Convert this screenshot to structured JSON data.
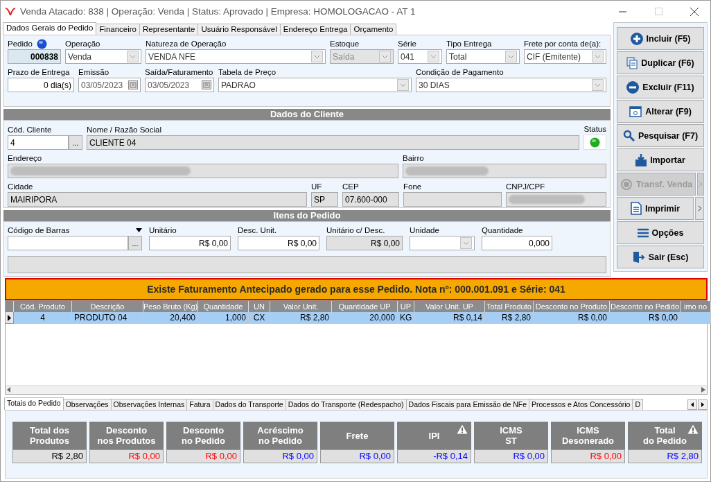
{
  "window": {
    "title": "Venda Atacado: 838 | Operação: Venda | Status: Aprovado | Empresa: HOMOLOGACAO - AT 1"
  },
  "tabs": [
    {
      "label": "Dados Gerais do Pedido",
      "selected": true
    },
    {
      "label": "Financeiro",
      "selected": false
    },
    {
      "label": "Representante",
      "selected": false
    },
    {
      "label": "Usuário Responsável",
      "selected": false
    },
    {
      "label": "Endereço Entrega",
      "selected": false
    },
    {
      "label": "Orçamento",
      "selected": false
    }
  ],
  "general": [
    [
      {
        "label": "Pedido",
        "kind": "id",
        "value": "000838",
        "color": "#1a4fd0"
      },
      {
        "label": "Operação",
        "kind": "combo",
        "value": "Venda",
        "disabled": false
      },
      {
        "label": "Natureza de Operação",
        "kind": "combo",
        "value": "VENDA NFE",
        "disabled": false
      },
      {
        "label": "Estoque",
        "kind": "combo",
        "value": "Saída",
        "disabled": true
      },
      {
        "label": "Série",
        "kind": "combo",
        "value": "041",
        "disabled": false
      },
      {
        "label": "Tipo Entrega",
        "kind": "combo",
        "value": "Total",
        "disabled": false
      },
      {
        "label": "Frete por conta de(a):",
        "kind": "combo",
        "value": "CIF (Emitente)",
        "disabled": false
      }
    ],
    [
      {
        "label": "Prazo de Entrega",
        "kind": "number",
        "value": "0 dia(s)"
      },
      {
        "label": "Emissão",
        "kind": "date",
        "value": "03/05/2023"
      },
      {
        "label": "Saída/Faturamento",
        "kind": "date",
        "value": "03/05/2023"
      },
      {
        "label": "Tabela de Preço",
        "kind": "combo",
        "value": "PADRAO",
        "disabled": false
      },
      {
        "label": "Condição de Pagamento",
        "kind": "combo",
        "value": "30 DIAS",
        "disabled": false
      }
    ]
  ],
  "client_section": {
    "title": "Dados do Cliente"
  },
  "client": [
    [
      {
        "label": "Cód. Cliente",
        "kind": "lookup",
        "value": "4",
        "button": "..."
      },
      {
        "label": "Nome / Razão Social",
        "kind": "readonly",
        "value": "CLIENTE 04"
      },
      {
        "label": "Status",
        "kind": "status",
        "color": "#1fae1f"
      }
    ],
    [
      {
        "label": "Endereço",
        "kind": "blurred"
      },
      {
        "label": "Bairro",
        "kind": "blurred"
      }
    ],
    [
      {
        "label": "Cidade",
        "kind": "readonly",
        "value": "MAIRIPORA"
      },
      {
        "label": "UF",
        "kind": "readonly",
        "value": "SP"
      },
      {
        "label": "CEP",
        "kind": "readonly",
        "value": "07.600-000"
      },
      {
        "label": "Fone",
        "kind": "readonly"
      },
      {
        "label": "CNPJ/CPF",
        "kind": "blurred"
      }
    ]
  ],
  "items_section": {
    "title": "Itens do Pedido"
  },
  "items": [
    [
      {
        "label": "Código de Barras",
        "kind": "lookup",
        "label_menu": true,
        "button": "..."
      },
      {
        "label": "Unitário",
        "kind": "number",
        "value": "R$ 0,00"
      },
      {
        "label": "Desc. Unit.",
        "kind": "number",
        "value": "R$ 0,00"
      },
      {
        "label": "Unitário c/ Desc.",
        "kind": "total",
        "value": "R$ 0,00"
      },
      {
        "label": "Unidade",
        "kind": "combo",
        "disabled": false
      },
      {
        "label": "Quantidade",
        "kind": "number",
        "value": "0,000"
      }
    ]
  ],
  "buttons": [
    {
      "label": "Incluir (F5)",
      "kind": "plus",
      "disabled": false,
      "menu": false
    },
    {
      "label": "Duplicar (F6)",
      "kind": "copy",
      "disabled": false,
      "menu": false
    },
    {
      "label": "Excluir (F11)",
      "kind": "minus",
      "disabled": false,
      "menu": false
    },
    {
      "label": "Alterar (F9)",
      "kind": "window",
      "disabled": false,
      "menu": false
    },
    {
      "label": "Pesquisar (F7)",
      "kind": "search",
      "disabled": false,
      "menu": false
    },
    {
      "label": "Importar",
      "kind": "import",
      "disabled": false,
      "menu": false
    },
    {
      "label": "Transf. Venda",
      "kind": "transfer",
      "disabled": true,
      "menu": true
    },
    {
      "label": "Imprimir",
      "kind": "document",
      "disabled": false,
      "menu": true
    },
    {
      "label": "Opções",
      "kind": "menu",
      "disabled": false,
      "menu": false
    },
    {
      "label": "Sair (Esc)",
      "kind": "exit",
      "disabled": false,
      "menu": false
    }
  ],
  "banner": {
    "text": "Existe Faturamento Antecipado gerado para esse Pedido. Nota nº: 000.001.091 e Série: 041"
  },
  "table": {
    "columns": [
      "Cód. Produto",
      "Descrição",
      "Peso Bruto (Kg)",
      "Quantidade",
      "UN",
      "Valor Unit.",
      "Quantidade UP",
      "UP",
      "Valor Unit. UP",
      "Total Produto",
      "Desconto no Produto",
      "Desconto no Pedido",
      "imo no"
    ],
    "rows": [
      {
        "selected": true,
        "cells": [
          "4",
          "PRODUTO 04",
          "20,400",
          "1,000",
          "CX",
          "R$ 2,80",
          "20,000",
          "KG",
          "R$ 0,14",
          "R$ 2,80",
          "R$ 0,00",
          "R$ 0,00",
          ""
        ]
      }
    ]
  },
  "bottom_tabs": [
    {
      "label": "Totais do Pedido",
      "selected": true
    },
    {
      "label": "Observações",
      "selected": false
    },
    {
      "label": "Observações Internas",
      "selected": false
    },
    {
      "label": "Fatura",
      "selected": false
    },
    {
      "label": "Dados do Transporte",
      "selected": false
    },
    {
      "label": "Dados do Transporte (Redespacho)",
      "selected": false
    },
    {
      "label": "Dados Fiscais para Emissão de NFe",
      "selected": false
    },
    {
      "label": "Processos e Atos Concessório",
      "selected": false
    },
    {
      "label": "D",
      "selected": false
    }
  ],
  "totals": [
    {
      "label": "Total dos\nProdutos",
      "value": "R$ 2,80",
      "color": "#000000",
      "warning": false
    },
    {
      "label": "Desconto\nnos Produtos",
      "value": "R$ 0,00",
      "color": "#ff0000",
      "warning": false
    },
    {
      "label": "Desconto\nno Pedido",
      "value": "R$ 0,00",
      "color": "#ff0000",
      "warning": false
    },
    {
      "label": "Acréscimo\nno Pedido",
      "value": "R$ 0,00",
      "color": "#0000ff",
      "warning": false
    },
    {
      "label": "Frete",
      "value": "R$ 0,00",
      "color": "#0000ff",
      "warning": false
    },
    {
      "label": "IPI",
      "value": "-R$ 0,14",
      "color": "#0000ff",
      "warning": true
    },
    {
      "label": "ICMS\nST",
      "value": "R$ 0,00",
      "color": "#0000ff",
      "warning": false
    },
    {
      "label": "ICMS\nDesonerado",
      "value": "R$ 0,00",
      "color": "#ff0000",
      "warning": false
    },
    {
      "label": "Total\ndo Pedido",
      "value": "R$ 2,80",
      "color": "#0000ff",
      "warning": true
    }
  ]
}
